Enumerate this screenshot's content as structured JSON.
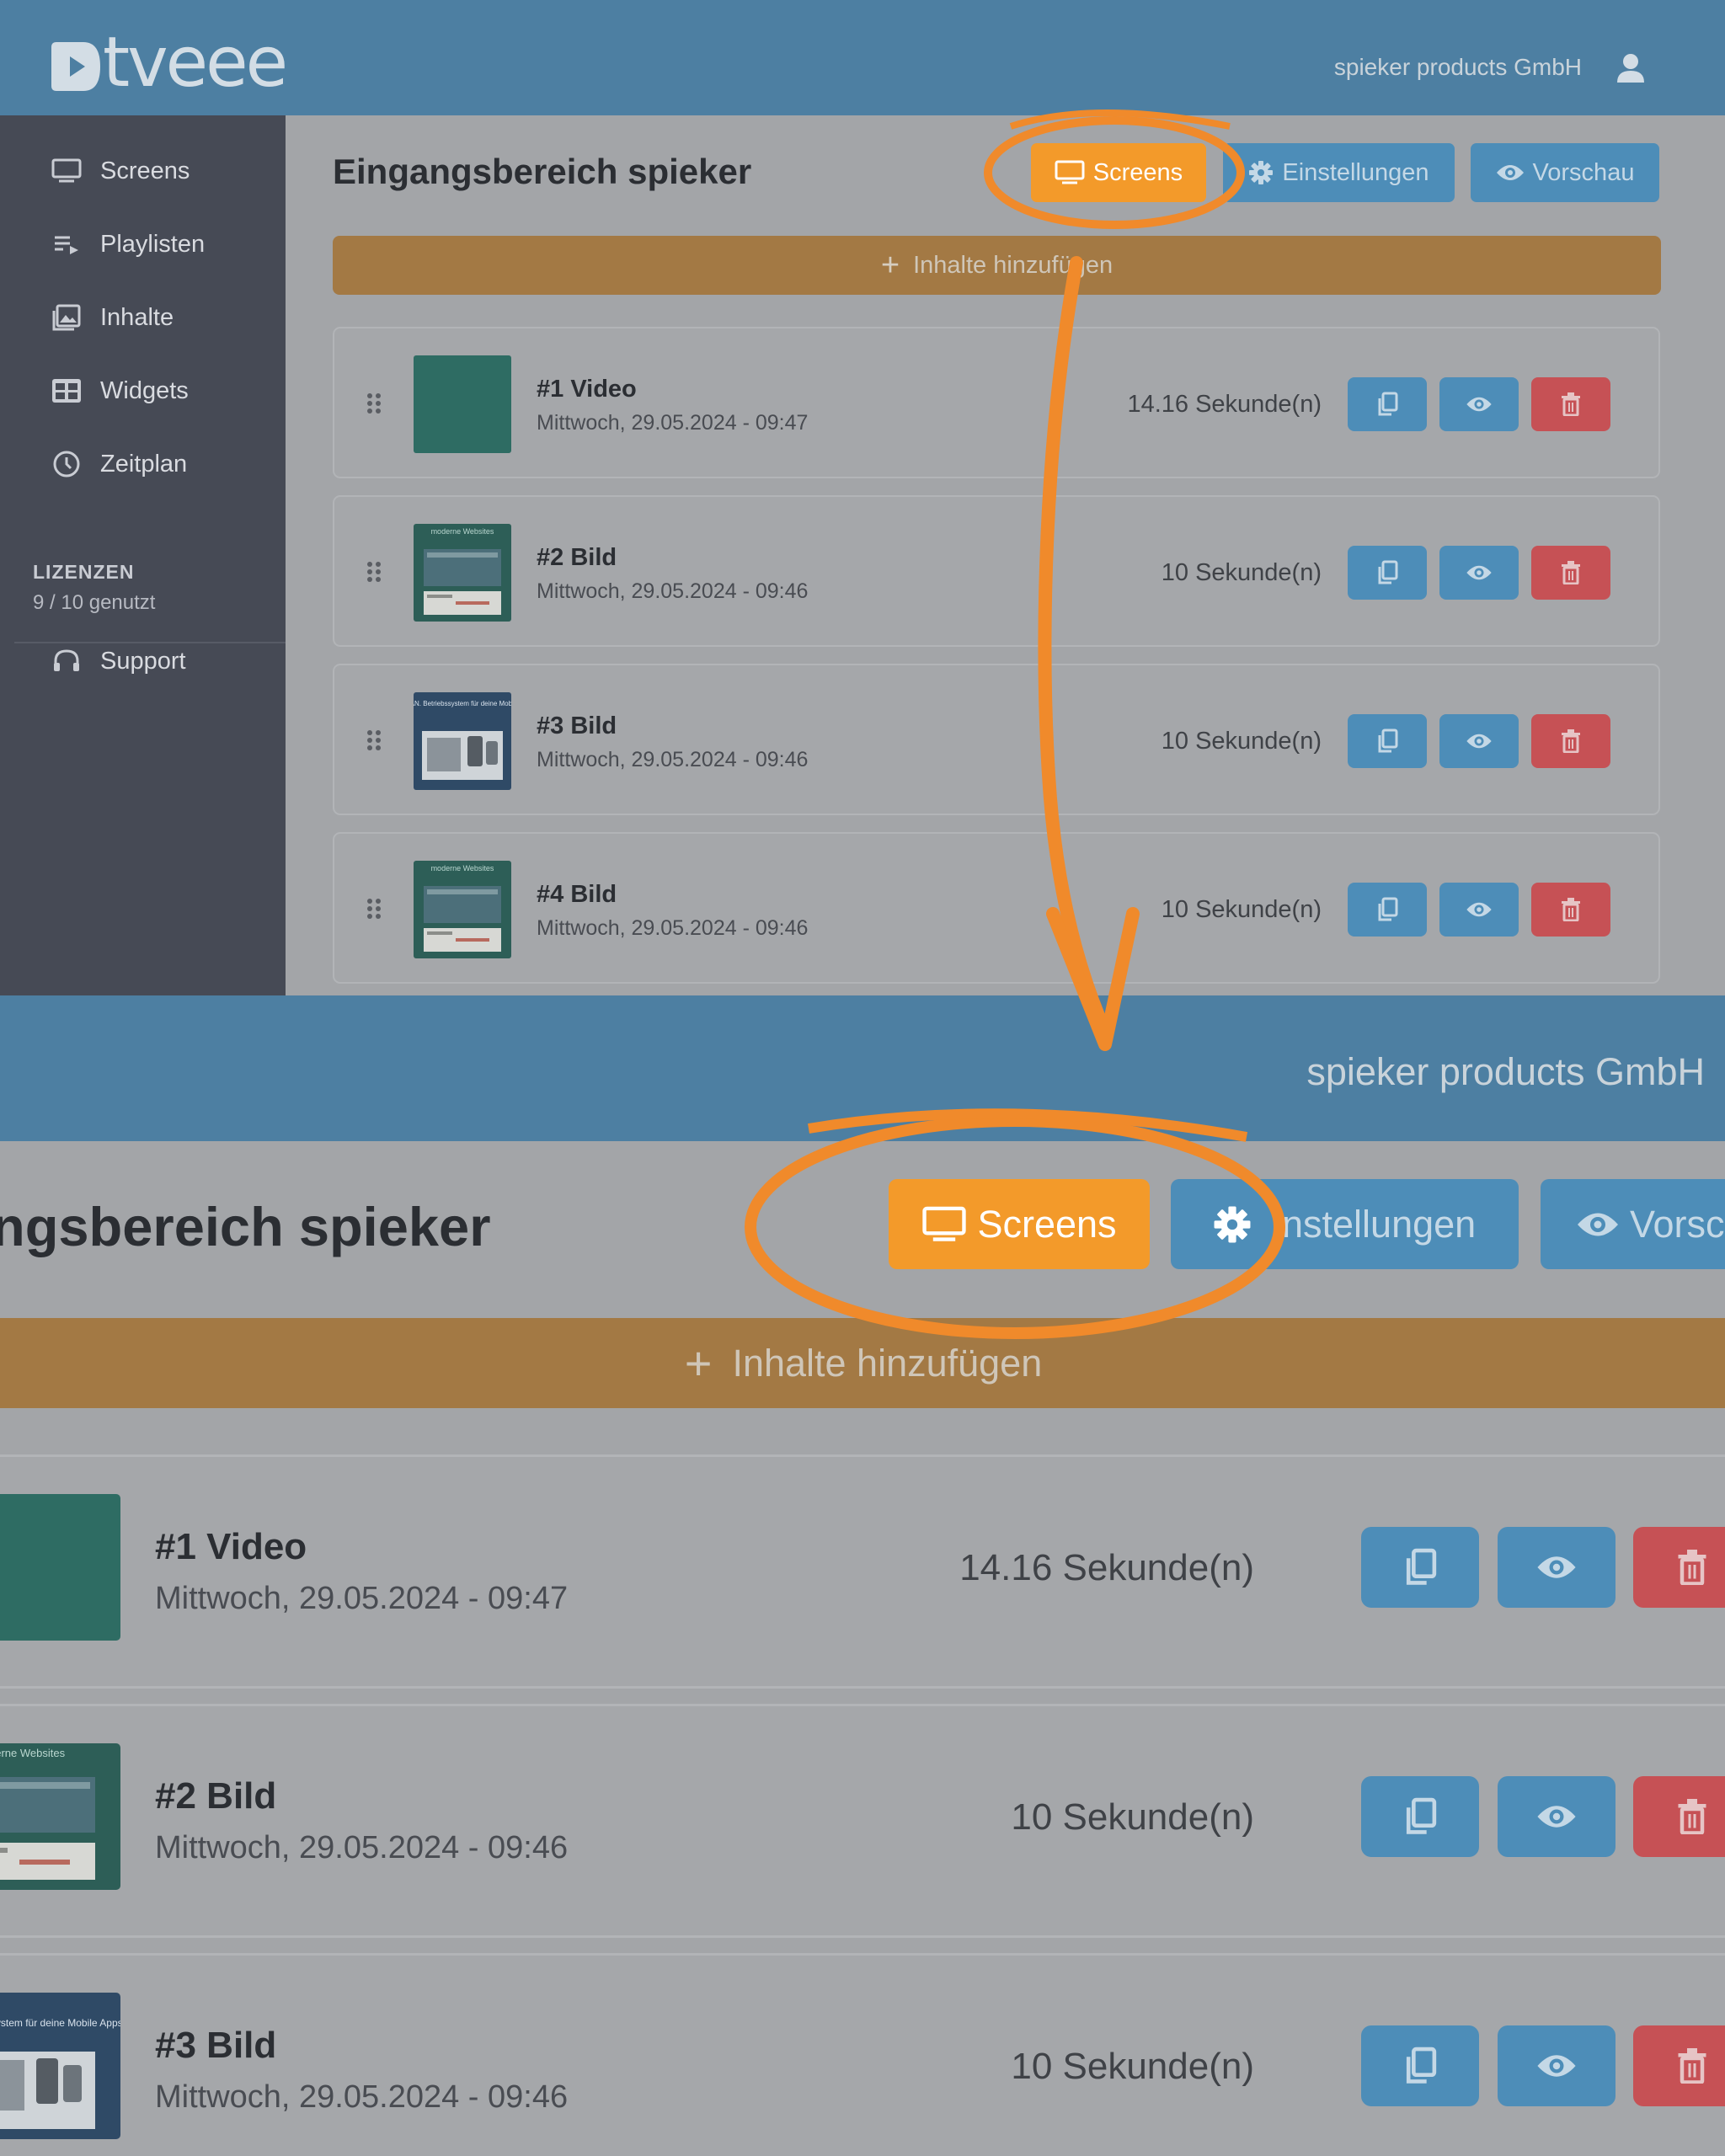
{
  "app": {
    "logo_text": "tveee",
    "company": "spieker products GmbH"
  },
  "sidebar": {
    "items": [
      {
        "label": "Screens",
        "icon": "monitor-icon"
      },
      {
        "label": "Playlisten",
        "icon": "playlist-icon"
      },
      {
        "label": "Inhalte",
        "icon": "image-icon"
      },
      {
        "label": "Widgets",
        "icon": "widgets-icon"
      },
      {
        "label": "Zeitplan",
        "icon": "clock-icon"
      }
    ],
    "license_title": "LIZENZEN",
    "license_usage": "9 / 10 genutzt",
    "support_label": "Support"
  },
  "page": {
    "title": "Eingangsbereich spieker",
    "screens_button": "Screens",
    "settings_button": "Einstellungen",
    "preview_button": "Vorschau",
    "add_content": "Inhalte hinzufügen"
  },
  "zoom": {
    "title": "ngsbereich spieker",
    "settings_button": "instellungen",
    "preview_button": "Vorsc"
  },
  "items": [
    {
      "title": "#1 Video",
      "date": "Mittwoch, 29.05.2024 - 09:47",
      "duration": "14.16 Sekunde(n)"
    },
    {
      "title": "#2 Bild",
      "date": "Mittwoch, 29.05.2024 - 09:46",
      "duration": "10 Sekunde(n)",
      "thumb_text": "moderne Websites"
    },
    {
      "title": "#3 Bild",
      "date": "Mittwoch, 29.05.2024 - 09:46",
      "duration": "10 Sekunde(n)",
      "thumb_text": "appTITAN. Betriebssystem für deine Mobile Apps"
    },
    {
      "title": "#4 Bild",
      "date": "Mittwoch, 29.05.2024 - 09:46",
      "duration": "10 Sekunde(n)",
      "thumb_text": "moderne Websites"
    }
  ],
  "colors": {
    "header": "#4d7fa2",
    "sidebar": "#464a55",
    "accent_orange": "#f39a2a",
    "button_blue": "#4d8db8",
    "danger_red": "#c65155",
    "annotation": "#f08a2b"
  }
}
